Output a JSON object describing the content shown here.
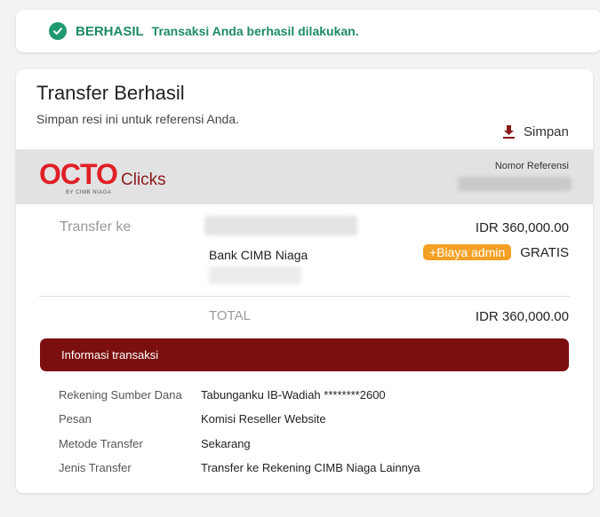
{
  "banner": {
    "status": "BERHASIL",
    "message": "Transaksi Anda berhasil dilakukan."
  },
  "receipt": {
    "title": "Transfer Berhasil",
    "subtitle": "Simpan resi ini untuk referensi Anda.",
    "save_label": "Simpan",
    "logo": {
      "brand": "OCTO",
      "product": "Clicks",
      "by_line": "BY CIMB NIAGA"
    },
    "reference_label": "Nomor Referensi",
    "transfer_to_label": "Transfer ke",
    "bank_name": "Bank CIMB Niaga",
    "amount": "IDR 360,000.00",
    "fee_badge": "+Biaya admin",
    "fee_value": "GRATIS",
    "total_label": "TOTAL",
    "total_value": "IDR 360,000.00"
  },
  "info": {
    "header": "Informasi transaksi",
    "rows": [
      {
        "key": "Rekening Sumber Dana",
        "value": "Tabunganku IB-Wadiah ********2600"
      },
      {
        "key": "Pesan",
        "value": "Komisi Reseller Website"
      },
      {
        "key": "Metode Transfer",
        "value": "Sekarang"
      },
      {
        "key": "Jenis Transfer",
        "value": "Transfer ke Rekening CIMB Niaga Lainnya"
      }
    ]
  },
  "colors": {
    "success": "#1e8a66",
    "brand_red": "#e11f26",
    "info_header_bg": "#7b0f0f",
    "fee_badge_bg": "#f4a024"
  },
  "icons": {
    "success": "check-circle-icon",
    "save": "download-icon"
  }
}
